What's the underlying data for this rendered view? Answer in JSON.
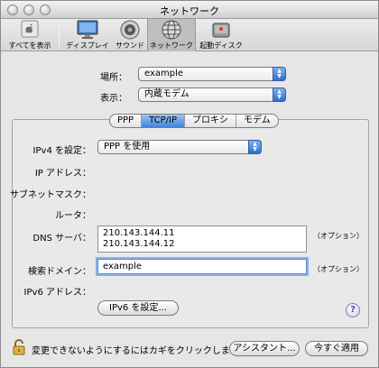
{
  "window": {
    "title": "ネットワーク"
  },
  "toolbar": {
    "items": [
      {
        "label": "すべてを表示",
        "icon": "apple-icon"
      },
      {
        "label": "ディスプレイ",
        "icon": "display-icon"
      },
      {
        "label": "サウンド",
        "icon": "speaker-icon"
      },
      {
        "label": "ネットワーク",
        "icon": "network-globe-icon",
        "selected": true
      },
      {
        "label": "起動ディスク",
        "icon": "disk-icon"
      }
    ]
  },
  "location": {
    "label": "場所：",
    "value": "example"
  },
  "show": {
    "label": "表示：",
    "value": "内蔵モデム"
  },
  "tabs": [
    {
      "label": "PPP",
      "active": false
    },
    {
      "label": "TCP/IP",
      "active": true
    },
    {
      "label": "プロキシ",
      "active": false
    },
    {
      "label": "モデム",
      "active": false
    }
  ],
  "ipv4": {
    "label": "IPv4 を設定：",
    "value": "PPP を使用"
  },
  "ip_address": {
    "label": "IP アドレス："
  },
  "subnet": {
    "label": "サブネットマスク："
  },
  "router": {
    "label": "ルータ："
  },
  "dns": {
    "label": "DNS サーバ：",
    "servers": [
      "210.143.144.11",
      "210.143.144.12"
    ],
    "option": "（オプション）"
  },
  "search_domain": {
    "label": "検索ドメイン：",
    "value": "example",
    "option": "（オプション）"
  },
  "ipv6": {
    "label": "IPv6 アドレス：",
    "button": "IPv6 を設定..."
  },
  "help": {
    "symbol": "?"
  },
  "footer": {
    "lock_text": "変更できないようにするにはカギをクリックします。",
    "assistant": "アシスタント...",
    "apply_now": "今すぐ適用"
  },
  "colors": {
    "accent": "#3d84de",
    "window_bg": "#e6e6e6"
  }
}
